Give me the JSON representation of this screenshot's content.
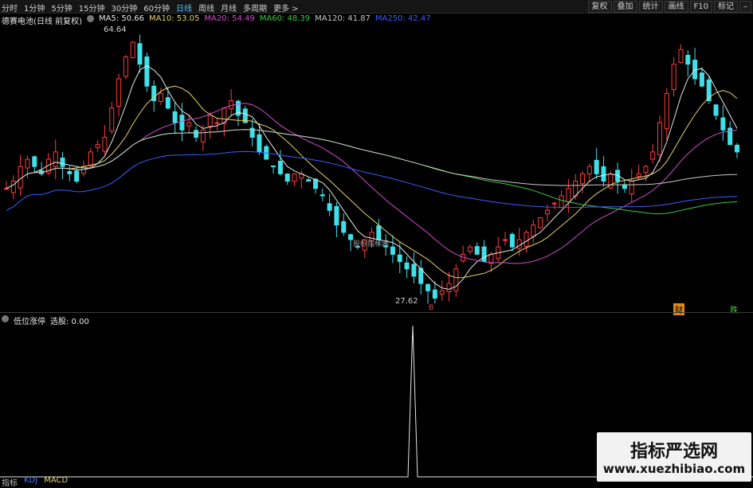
{
  "toolbar": {
    "periods": [
      "分时",
      "1分钟",
      "5分钟",
      "15分钟",
      "30分钟",
      "60分钟",
      "日线",
      "周线",
      "月线",
      "多周期",
      "更多 >"
    ],
    "active_period": "日线",
    "right_buttons": [
      "复权",
      "叠加",
      "统计",
      "画线",
      "F10",
      "标记",
      "–"
    ]
  },
  "info_bar": {
    "title": "德赛电池(日线 前复权)",
    "ma": [
      {
        "label": "MA5: 50.66",
        "color": "#e6e6e6"
      },
      {
        "label": "MA10: 53.05",
        "color": "#e6d36a"
      },
      {
        "label": "MA20: 54.49",
        "color": "#d04bd0"
      },
      {
        "label": "MA60: 48.39",
        "color": "#3ec83e"
      },
      {
        "label": "MA120: 41.87",
        "color": "#c8c8c8"
      },
      {
        "label": "MA250: 42.47",
        "color": "#3a5cff"
      }
    ]
  },
  "chart_labels": {
    "high": "64.64",
    "low": "27.62",
    "watermark_small": "股标指标网",
    "tag_red": "B",
    "tag_finance": "财",
    "tag_jump": "跌"
  },
  "indicator": {
    "name": "低位涨停",
    "value_label": "选股: 0.00"
  },
  "bottom_bar": [
    {
      "label": "指标",
      "color": "#bbbbbb"
    },
    {
      "label": "KDJ",
      "color": "#3a7cff"
    },
    {
      "label": "MACD",
      "color": "#e6d36a"
    }
  ],
  "watermark": {
    "title": "指标严选网",
    "url": "www.xuezhibiao.com"
  },
  "chart_data": {
    "type": "candlestick",
    "y_min": 27.62,
    "y_max": 64.64,
    "closes": [
      43,
      44,
      46,
      47,
      46,
      45,
      47,
      48,
      46,
      45,
      44,
      46,
      48,
      49,
      50,
      54,
      58,
      61,
      63,
      60,
      57,
      55,
      56,
      54,
      52,
      51,
      52,
      50,
      51,
      53,
      52,
      54,
      55,
      53,
      52,
      50,
      48,
      47,
      46,
      45,
      44,
      45,
      45,
      44,
      43,
      42,
      40,
      38,
      37,
      36,
      35,
      36,
      37,
      36,
      35,
      34,
      33,
      32,
      31,
      30,
      29,
      28,
      29,
      30,
      32,
      34,
      35,
      34,
      33,
      34,
      35,
      36,
      35,
      36,
      37,
      38,
      39,
      40,
      41,
      42,
      43,
      44,
      45,
      46,
      45,
      44,
      45,
      44,
      43,
      44,
      45,
      46,
      48,
      52,
      56,
      60,
      62,
      60,
      58,
      57,
      55,
      53,
      51,
      49,
      48
    ]
  }
}
